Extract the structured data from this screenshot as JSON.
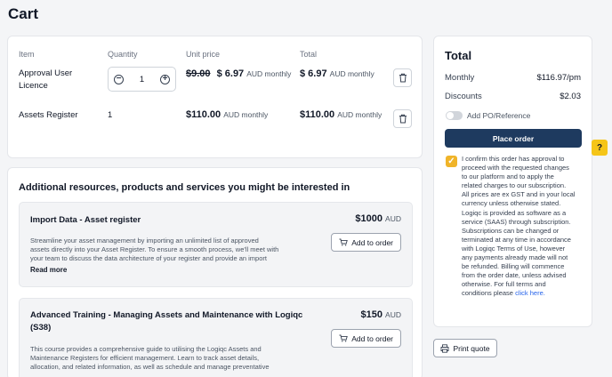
{
  "page": {
    "title": "Cart"
  },
  "cart": {
    "headers": {
      "item": "Item",
      "quantity": "Quantity",
      "unit_price": "Unit price",
      "total": "Total"
    },
    "rows": [
      {
        "name_line1": "Approval User",
        "name_line2": "Licence",
        "quantity": "1",
        "old_price": "$9.00",
        "unit_price": "$ 6.97",
        "unit_suffix": "AUD monthly",
        "total": "$ 6.97",
        "total_suffix": "AUD monthly"
      },
      {
        "name_line1": "Assets Register",
        "quantity": "1",
        "unit_price": "$110.00",
        "unit_suffix": "AUD monthly",
        "total": "$110.00",
        "total_suffix": "AUD monthly"
      }
    ]
  },
  "suggestions": {
    "title": "Additional resources, products and services you might be interested in",
    "products": [
      {
        "name": "Import Data - Asset register",
        "price": "$1000",
        "price_suffix": "AUD",
        "add_label": "Add to order",
        "desc_lines": [
          "Streamline your asset management by importing an unlimited list of approved",
          "assets directly into your Asset Register. To ensure a smooth process, we'll meet with",
          "your team to discuss the data architecture of your register and provide an import"
        ],
        "read_more": "Read more"
      },
      {
        "name_line1": "Advanced Training - Managing Assets and Maintenance with Logiqc",
        "name_line2": "(S38)",
        "price": "$150",
        "price_suffix": "AUD",
        "add_label": "Add to order",
        "desc_lines": [
          "This course provides a comprehensive guide to utilising the Logiqc Assets and",
          "Maintenance Registers for efficient management. Learn to track asset details,",
          "allocation, and related information, as well as schedule and manage preventative"
        ]
      }
    ]
  },
  "summary": {
    "title": "Total",
    "monthly_label": "Monthly",
    "monthly_value": "$116.97/pm",
    "discounts_label": "Discounts",
    "discounts_value": "$2.03",
    "po_label": "Add PO/Reference",
    "place_order": "Place order",
    "confirm_lines": [
      "I confirm this order has approval to",
      "proceed with the requested changes",
      "to our platform and to apply the",
      "related charges to our subscription.",
      "All prices are ex GST and in your local",
      "currency unless otherwise stated.",
      "Logiqc is provided as software as a",
      "service (SAAS) through subscription.",
      "Subscriptions can be changed or",
      "terminated at any time in accordance",
      "with Logiqc Terms of Use, however",
      "any payments already made will not",
      "be refunded. Billing will commence",
      "from the order date, unless advised",
      "otherwise. For full terms and"
    ],
    "confirm_last": "conditions please",
    "confirm_link": "click here."
  },
  "help": {
    "label": "?"
  },
  "print": {
    "label": "Print quote"
  },
  "colors": {
    "primary": "#1e3a5f",
    "accent": "#f0b429",
    "help": "#f5c518",
    "link": "#2563eb"
  },
  "icons": {
    "minus": "minus-icon",
    "plus": "plus-icon",
    "trash": "trash-icon",
    "cart": "cart-icon",
    "check": "check-icon",
    "printer": "printer-icon"
  }
}
